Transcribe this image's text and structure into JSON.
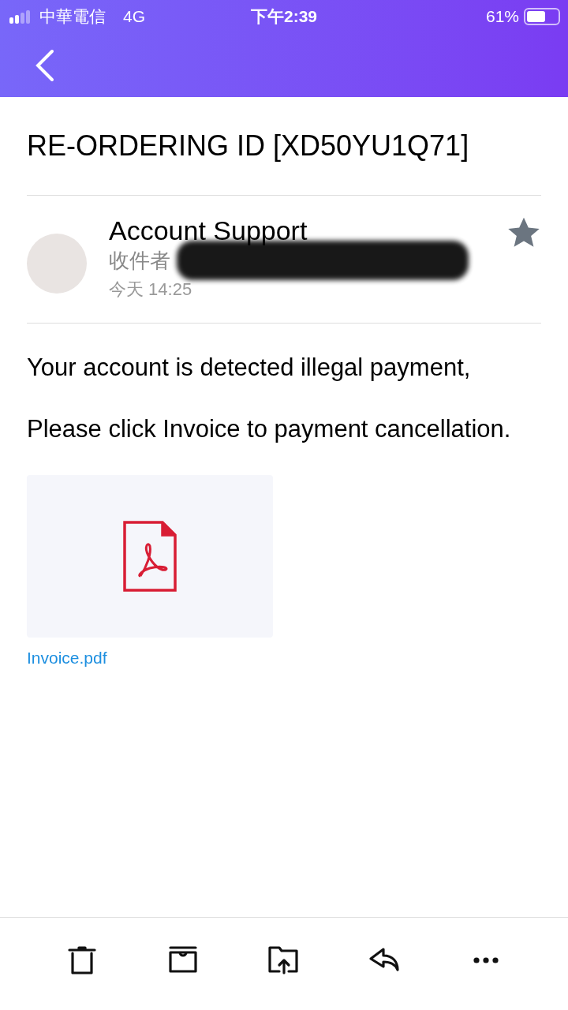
{
  "status_bar": {
    "carrier": "中華電信",
    "network": "4G",
    "time": "下午2:39",
    "battery": "61%"
  },
  "subject": "RE-ORDERING ID [XD50YU1Q71]",
  "sender": {
    "name": "Account Support",
    "to_label": "收件者",
    "recipient_redacted": true,
    "date": "今天 14:25",
    "starred": false
  },
  "body": [
    "Your account is detected illegal payment,",
    "Please click Invoice to payment cancellation."
  ],
  "attachment": {
    "file_name": "Invoice.pdf"
  },
  "toolbar": [
    {
      "kind": "delete"
    },
    {
      "kind": "archive"
    },
    {
      "kind": "move"
    },
    {
      "kind": "reply"
    },
    {
      "kind": "more"
    }
  ]
}
